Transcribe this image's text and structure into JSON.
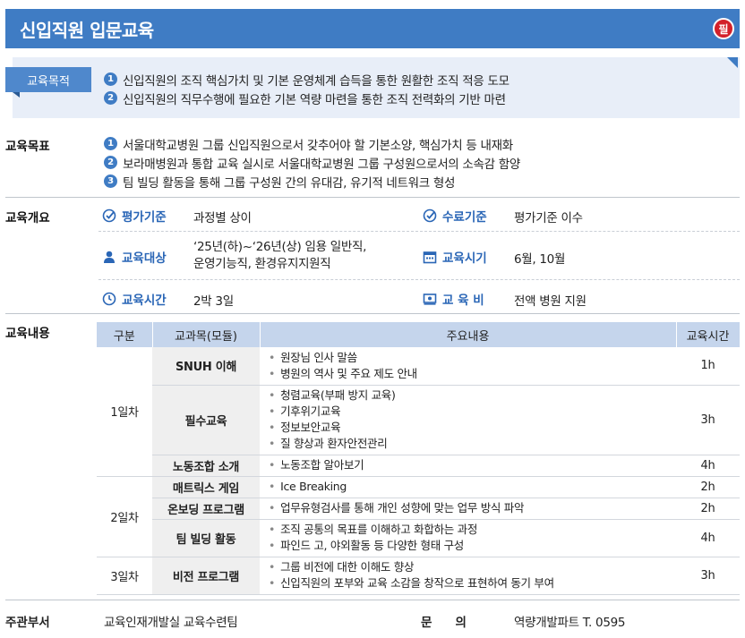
{
  "header": {
    "title": "신입직원 입문교육",
    "badge": "필"
  },
  "purpose": {
    "label": "교육목적",
    "items": [
      {
        "num": "1",
        "text": "신입직원의 조직 핵심가치 및 기본 운영체계 습득을 통한 원활한 조직 적응 도모"
      },
      {
        "num": "2",
        "text": "신입직원의 직무수행에 필요한 기본 역량 마련을 통한 조직 전력화의 기반 마련"
      }
    ]
  },
  "goals": {
    "label": "교육목표",
    "items": [
      {
        "num": "1",
        "text": "서울대학교병원 그룹 신입직원으로서 갖추어야 할 기본소양, 핵심가치 등 내재화"
      },
      {
        "num": "2",
        "text": "보라매병원과 통합 교육 실시로 서울대학교병원 그룹 구성원으로서의 소속감 함양"
      },
      {
        "num": "3",
        "text": "팀 빌딩 활동을 통해 그룹 구성원 간의 유대감, 유기적 네트워크 형성"
      }
    ]
  },
  "overview": {
    "label": "교육개요",
    "eval_key": "평가기준",
    "eval_val": "과정별 상이",
    "complete_key": "수료기준",
    "complete_val": "평가기준 이수",
    "target_key": "교육대상",
    "target_val_1": "‘25년(하)~‘26년(상) 임용 일반직,",
    "target_val_2": "운영기능직, 환경유지지원직",
    "period_key": "교육시기",
    "period_val": "6월, 10월",
    "time_key": "교육시간",
    "time_val": "2박 3일",
    "cost_key": "교 육 비",
    "cost_val": "전액 병원 지원"
  },
  "content": {
    "label": "교육내용",
    "headers": [
      "구분",
      "교과목(모듈)",
      "주요내용",
      "교육시간"
    ],
    "days": [
      "1일차",
      "2일차",
      "3일차"
    ],
    "rows": [
      {
        "module": "SNUH 이해",
        "items": [
          "원장님 인사 말씀",
          "병원의 역사 및 주요 제도 안내"
        ],
        "hours": "1h"
      },
      {
        "module": "필수교육",
        "items": [
          "청렴교육(부패 방지 교육)",
          "기후위기교육",
          "정보보안교육",
          "질 향상과 환자안전관리"
        ],
        "hours": "3h"
      },
      {
        "module": "노동조합 소개",
        "items": [
          "노동조합 알아보기"
        ],
        "hours": "4h"
      },
      {
        "module": "매트릭스 게임",
        "items": [
          "Ice Breaking"
        ],
        "hours": "2h"
      },
      {
        "module": "온보딩 프로그램",
        "items": [
          "업무유형검사를 통해 개인 성향에 맞는 업무 방식 파악"
        ],
        "hours": "2h"
      },
      {
        "module": "팀 빌딩 활동",
        "items": [
          "조직 공통의 목표를 이해하고 화합하는 과정",
          "파인드 고, 야외활동 등 다양한 형태 구성"
        ],
        "hours": "4h"
      },
      {
        "module": "비전 프로그램",
        "items": [
          "그룹 비전에 대한 이해도 향상",
          "신입직원의 포부와 교육 소감을 창작으로 표현하여 동기 부여"
        ],
        "hours": "3h"
      }
    ]
  },
  "footer": {
    "dept_label": "주관부서",
    "dept_val": "교육인재개발실 교육수련팀",
    "inquiry_label": "문　　의",
    "inquiry_val": "역량개발파트 T. 0595"
  },
  "colors": {
    "primary": "#3f7cc4",
    "badge": "#d3202a",
    "purpose_bg": "#e8eef8",
    "table_header": "#c5d5ec"
  }
}
